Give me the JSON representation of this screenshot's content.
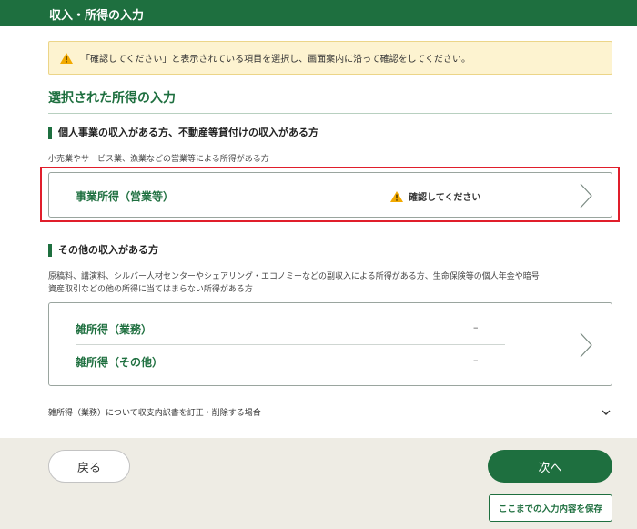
{
  "header": {
    "title": "収入・所得の入力"
  },
  "alert": {
    "text": "「確認してください」と表示されている項目を選択し、画面案内に沿って確認をしてください。",
    "icon": "warning-icon"
  },
  "section": {
    "title": "選択された所得の入力"
  },
  "business": {
    "heading": "個人事業の収入がある方、不動産等貸付けの収入がある方",
    "description": "小売業やサービス業、漁業などの営業等による所得がある方",
    "card": {
      "label": "事業所得（営業等）",
      "status": "確認してください"
    }
  },
  "other": {
    "heading": "その他の収入がある方",
    "description_line1": "原稿料、講演料、シルバー人材センターやシェアリング・エコノミーなどの副収入による所得がある方、生命保険等の個人年金や暗号",
    "description_line2": "資産取引などの他の所得に当てはまらない所得がある方",
    "rows": [
      {
        "label": "雑所得（業務）",
        "value": "–"
      },
      {
        "label": "雑所得（その他）",
        "value": "–"
      }
    ]
  },
  "accordion": {
    "label": "雑所得（業務）について収支内訳書を訂正・削除する場合"
  },
  "footer": {
    "back_label": "戻る",
    "next_label": "次へ",
    "save_label": "ここまでの入力内容を保存"
  },
  "colors": {
    "brand": "#1e6f3f",
    "warning": "#f2a900",
    "highlight": "#e01e2b",
    "alert_bg": "#fdf3d0",
    "footer_bg": "#eeece4"
  }
}
